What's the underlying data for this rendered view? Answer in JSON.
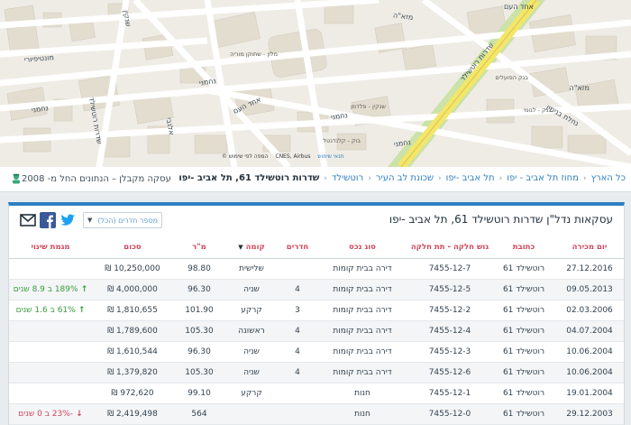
{
  "map": {
    "streets": [
      "שדרות רוטשילד",
      "מזא\"ה",
      "מזא\"ה",
      "נחמני",
      "נחמני",
      "נחמני",
      "נחמני",
      "מונטיפיורי",
      "אחד העם",
      "אלנבי",
      "שדרות רוטשילד",
      "שנקין",
      "אחד העם",
      "נחלת בנימין"
    ],
    "places": [
      "מלון - שתוקן מוריה",
      "שנקין - פלדמן",
      "בנק - לגומי",
      "בוק - קלנדנטל",
      "בנק הפועלים"
    ],
    "attribution": [
      "CNES, Airbus",
      "תנאי שימוש",
      "© המפה לפי שימוש"
    ]
  },
  "breadcrumb": {
    "items": [
      "כל הארץ",
      "מחוז תל אביב - יפו",
      "תל אביב -יפו",
      "שכונת לב העיר",
      "רוטשילד",
      "שדרות רוטשילד 61, תל אביב -יפו"
    ],
    "contractor": "עסקה מקבלן – הנתונים החל מ- 2008"
  },
  "card": {
    "title": "עסקאות נדל\"ן שדרות רוטשילד 61, תל אביב -יפו",
    "rooms_filter": "מספר חדרים (הכל)",
    "columns": [
      "יום מכירה",
      "כתובת",
      "גוש חלקה - תת חלקה",
      "סוג נכס",
      "חדרים",
      "קומה",
      "מ\"ר",
      "סכום",
      "מגמת שינוי"
    ],
    "rows": [
      {
        "date": "27.12.2016",
        "address": "רוטשילד 61",
        "parcel": "7455-12-7",
        "type": "דירה בבית קומות",
        "rooms": "",
        "floor": "שלישית",
        "sqm": "98.80",
        "amount": "10,250,000 ₪",
        "trend": "",
        "dir": ""
      },
      {
        "date": "09.05.2013",
        "address": "רוטשילד 61",
        "parcel": "7455-12-5",
        "type": "דירה בבית קומות",
        "rooms": "4",
        "floor": "שניה",
        "sqm": "96.30",
        "amount": "4,000,000 ₪",
        "trend": "189% ב 8.9 שנים",
        "dir": "up"
      },
      {
        "date": "02.03.2006",
        "address": "רוטשילד 61",
        "parcel": "7455-12-2",
        "type": "דירה בבית קומות",
        "rooms": "3",
        "floor": "קרקע",
        "sqm": "101.90",
        "amount": "1,810,655 ₪",
        "trend": "61% ב 1.6 שנים",
        "dir": "up"
      },
      {
        "date": "04.07.2004",
        "address": "רוטשילד 61",
        "parcel": "7455-12-4",
        "type": "דירה בבית קומות",
        "rooms": "4",
        "floor": "ראשונה",
        "sqm": "105.30",
        "amount": "1,789,600 ₪",
        "trend": "",
        "dir": ""
      },
      {
        "date": "10.06.2004",
        "address": "רוטשילד 61",
        "parcel": "7455-12-3",
        "type": "דירה בבית קומות",
        "rooms": "4",
        "floor": "שניה",
        "sqm": "96.30",
        "amount": "1,610,544 ₪",
        "trend": "",
        "dir": ""
      },
      {
        "date": "10.06.2004",
        "address": "רוטשילד 61",
        "parcel": "7455-12-6",
        "type": "דירה בבית קומות",
        "rooms": "4",
        "floor": "שניה",
        "sqm": "105.30",
        "amount": "1,379,820 ₪",
        "trend": "",
        "dir": ""
      },
      {
        "date": "19.01.2004",
        "address": "רוטשילד 61",
        "parcel": "7455-12-1",
        "type": "חנות",
        "rooms": "",
        "floor": "קרקע",
        "sqm": "99.10",
        "amount": "972,620 ₪",
        "trend": "",
        "dir": ""
      },
      {
        "date": "29.12.2003",
        "address": "רוטשילד 61",
        "parcel": "7455-12-0",
        "type": "חנות",
        "rooms": "",
        "floor": "",
        "sqm": "564",
        "amount": "2,419,498 ₪",
        "trend": "-23% ב 0 שנים",
        "dir": "down"
      }
    ]
  },
  "colors": {
    "accent": "#2f7fc1",
    "header_text": "#d0475a",
    "up": "#3b9c3b",
    "down": "#d0475a",
    "park": "#cbe2a8",
    "main_road": "#f4e56b"
  },
  "icons": [
    "email-icon",
    "facebook-icon",
    "twitter-icon",
    "contractor-icon",
    "sort-down-icon"
  ]
}
